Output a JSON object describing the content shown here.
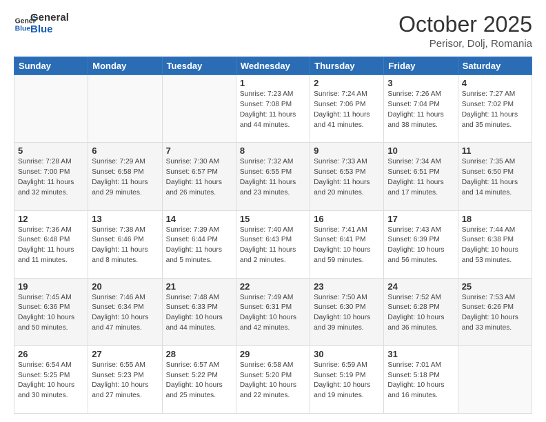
{
  "header": {
    "logo_line1": "General",
    "logo_line2": "Blue",
    "month": "October 2025",
    "location": "Perisor, Dolj, Romania"
  },
  "weekdays": [
    "Sunday",
    "Monday",
    "Tuesday",
    "Wednesday",
    "Thursday",
    "Friday",
    "Saturday"
  ],
  "rows": [
    [
      {
        "day": "",
        "info": ""
      },
      {
        "day": "",
        "info": ""
      },
      {
        "day": "",
        "info": ""
      },
      {
        "day": "1",
        "info": "Sunrise: 7:23 AM\nSunset: 7:08 PM\nDaylight: 11 hours\nand 44 minutes."
      },
      {
        "day": "2",
        "info": "Sunrise: 7:24 AM\nSunset: 7:06 PM\nDaylight: 11 hours\nand 41 minutes."
      },
      {
        "day": "3",
        "info": "Sunrise: 7:26 AM\nSunset: 7:04 PM\nDaylight: 11 hours\nand 38 minutes."
      },
      {
        "day": "4",
        "info": "Sunrise: 7:27 AM\nSunset: 7:02 PM\nDaylight: 11 hours\nand 35 minutes."
      }
    ],
    [
      {
        "day": "5",
        "info": "Sunrise: 7:28 AM\nSunset: 7:00 PM\nDaylight: 11 hours\nand 32 minutes."
      },
      {
        "day": "6",
        "info": "Sunrise: 7:29 AM\nSunset: 6:58 PM\nDaylight: 11 hours\nand 29 minutes."
      },
      {
        "day": "7",
        "info": "Sunrise: 7:30 AM\nSunset: 6:57 PM\nDaylight: 11 hours\nand 26 minutes."
      },
      {
        "day": "8",
        "info": "Sunrise: 7:32 AM\nSunset: 6:55 PM\nDaylight: 11 hours\nand 23 minutes."
      },
      {
        "day": "9",
        "info": "Sunrise: 7:33 AM\nSunset: 6:53 PM\nDaylight: 11 hours\nand 20 minutes."
      },
      {
        "day": "10",
        "info": "Sunrise: 7:34 AM\nSunset: 6:51 PM\nDaylight: 11 hours\nand 17 minutes."
      },
      {
        "day": "11",
        "info": "Sunrise: 7:35 AM\nSunset: 6:50 PM\nDaylight: 11 hours\nand 14 minutes."
      }
    ],
    [
      {
        "day": "12",
        "info": "Sunrise: 7:36 AM\nSunset: 6:48 PM\nDaylight: 11 hours\nand 11 minutes."
      },
      {
        "day": "13",
        "info": "Sunrise: 7:38 AM\nSunset: 6:46 PM\nDaylight: 11 hours\nand 8 minutes."
      },
      {
        "day": "14",
        "info": "Sunrise: 7:39 AM\nSunset: 6:44 PM\nDaylight: 11 hours\nand 5 minutes."
      },
      {
        "day": "15",
        "info": "Sunrise: 7:40 AM\nSunset: 6:43 PM\nDaylight: 11 hours\nand 2 minutes."
      },
      {
        "day": "16",
        "info": "Sunrise: 7:41 AM\nSunset: 6:41 PM\nDaylight: 10 hours\nand 59 minutes."
      },
      {
        "day": "17",
        "info": "Sunrise: 7:43 AM\nSunset: 6:39 PM\nDaylight: 10 hours\nand 56 minutes."
      },
      {
        "day": "18",
        "info": "Sunrise: 7:44 AM\nSunset: 6:38 PM\nDaylight: 10 hours\nand 53 minutes."
      }
    ],
    [
      {
        "day": "19",
        "info": "Sunrise: 7:45 AM\nSunset: 6:36 PM\nDaylight: 10 hours\nand 50 minutes."
      },
      {
        "day": "20",
        "info": "Sunrise: 7:46 AM\nSunset: 6:34 PM\nDaylight: 10 hours\nand 47 minutes."
      },
      {
        "day": "21",
        "info": "Sunrise: 7:48 AM\nSunset: 6:33 PM\nDaylight: 10 hours\nand 44 minutes."
      },
      {
        "day": "22",
        "info": "Sunrise: 7:49 AM\nSunset: 6:31 PM\nDaylight: 10 hours\nand 42 minutes."
      },
      {
        "day": "23",
        "info": "Sunrise: 7:50 AM\nSunset: 6:30 PM\nDaylight: 10 hours\nand 39 minutes."
      },
      {
        "day": "24",
        "info": "Sunrise: 7:52 AM\nSunset: 6:28 PM\nDaylight: 10 hours\nand 36 minutes."
      },
      {
        "day": "25",
        "info": "Sunrise: 7:53 AM\nSunset: 6:26 PM\nDaylight: 10 hours\nand 33 minutes."
      }
    ],
    [
      {
        "day": "26",
        "info": "Sunrise: 6:54 AM\nSunset: 5:25 PM\nDaylight: 10 hours\nand 30 minutes."
      },
      {
        "day": "27",
        "info": "Sunrise: 6:55 AM\nSunset: 5:23 PM\nDaylight: 10 hours\nand 27 minutes."
      },
      {
        "day": "28",
        "info": "Sunrise: 6:57 AM\nSunset: 5:22 PM\nDaylight: 10 hours\nand 25 minutes."
      },
      {
        "day": "29",
        "info": "Sunrise: 6:58 AM\nSunset: 5:20 PM\nDaylight: 10 hours\nand 22 minutes."
      },
      {
        "day": "30",
        "info": "Sunrise: 6:59 AM\nSunset: 5:19 PM\nDaylight: 10 hours\nand 19 minutes."
      },
      {
        "day": "31",
        "info": "Sunrise: 7:01 AM\nSunset: 5:18 PM\nDaylight: 10 hours\nand 16 minutes."
      },
      {
        "day": "",
        "info": ""
      }
    ]
  ]
}
